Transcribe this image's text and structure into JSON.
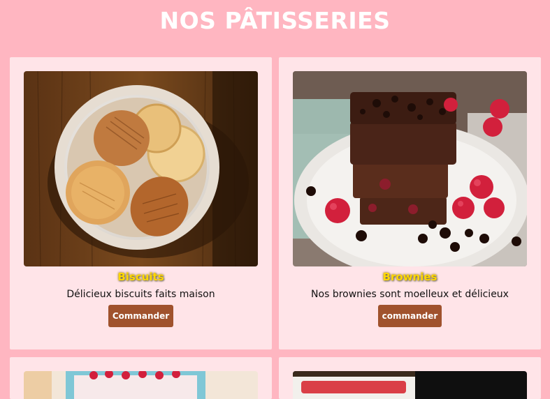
{
  "page": {
    "title": "NOS PÂTISSERIES"
  },
  "products": [
    {
      "name": "Biscuits",
      "description": "Délicieux biscuits faits maison",
      "button_label": "Commander",
      "image_icon": "cookies-bowl-photo"
    },
    {
      "name": "Brownies",
      "description": "Nos brownies sont moelleux et délicieux",
      "button_label": "commander",
      "image_icon": "brownies-raspberries-photo"
    },
    {
      "name": "",
      "description": "",
      "button_label": "",
      "image_icon": "raspberry-cake-photo"
    },
    {
      "name": "",
      "description": "",
      "button_label": "",
      "image_icon": "nutella-jar-photo"
    }
  ],
  "colors": {
    "background": "#ffb6c1",
    "card_background": "#ffe4e8",
    "title_color": "#ffffff",
    "product_name_color": "#ffd700",
    "button_background": "#a0522d",
    "button_text": "#ffffff"
  }
}
